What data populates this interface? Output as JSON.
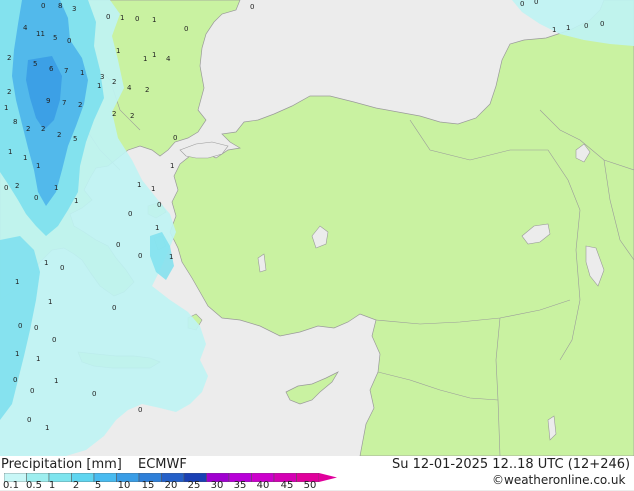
{
  "title": "Precipitation [mm]",
  "model": "ECMWF",
  "datetime": "Su 12-01-2025 12..18 UTC (12+246)",
  "credit": "©weatheronline.co.uk",
  "scale": {
    "labels": [
      "0.1",
      "0.5",
      "1",
      "2",
      "5",
      "10",
      "15",
      "20",
      "25",
      "30",
      "35",
      "40",
      "45",
      "50"
    ],
    "colors": [
      "#c8f7f7",
      "#9eeeef",
      "#7de4ee",
      "#5fd5f0",
      "#49bbf0",
      "#3a9de6",
      "#2f7fd8",
      "#2560c8",
      "#1a40b4",
      "#a000d0",
      "#b800d8",
      "#cc00cc",
      "#d400b4",
      "#e0009c"
    ]
  },
  "colors": {
    "sea": "#ececec",
    "land": "#c9f2a1",
    "coast": "#9a9a9a",
    "precip_light": "#bff3f3",
    "precip_medium": "#7fe0ee",
    "precip_heavy": "#4fb6ea"
  },
  "precip_labels": [
    {
      "t": "0"
    },
    {
      "t": "8"
    },
    {
      "t": "3"
    },
    {
      "t": "0"
    },
    {
      "t": "1"
    },
    {
      "t": "0"
    },
    {
      "t": "1"
    },
    {
      "t": "0"
    },
    {
      "t": "0"
    },
    {
      "t": "4"
    },
    {
      "t": "11"
    },
    {
      "t": "5"
    },
    {
      "t": "0"
    },
    {
      "t": "1"
    },
    {
      "t": "2"
    },
    {
      "t": "5"
    },
    {
      "t": "6"
    },
    {
      "t": "7"
    },
    {
      "t": "1"
    },
    {
      "t": "3"
    },
    {
      "t": "2"
    },
    {
      "t": "9"
    },
    {
      "t": "7"
    },
    {
      "t": "2"
    },
    {
      "t": "1"
    },
    {
      "t": "2"
    },
    {
      "t": "2"
    },
    {
      "t": "4"
    },
    {
      "t": "2"
    },
    {
      "t": "8"
    },
    {
      "t": "2"
    },
    {
      "t": "2"
    },
    {
      "t": "2"
    },
    {
      "t": "5"
    },
    {
      "t": "1"
    },
    {
      "t": "1"
    },
    {
      "t": "4"
    },
    {
      "t": "1"
    },
    {
      "t": "1"
    },
    {
      "t": "1"
    },
    {
      "t": "2"
    },
    {
      "t": "1"
    },
    {
      "t": "0"
    },
    {
      "t": "1"
    },
    {
      "t": "0"
    },
    {
      "t": "1"
    },
    {
      "t": "1"
    },
    {
      "t": "0"
    },
    {
      "t": "0"
    },
    {
      "t": "1"
    },
    {
      "t": "0"
    },
    {
      "t": "0"
    },
    {
      "t": "1"
    },
    {
      "t": "1"
    },
    {
      "t": "0"
    },
    {
      "t": "0"
    },
    {
      "t": "0"
    },
    {
      "t": "1"
    },
    {
      "t": "1"
    },
    {
      "t": "0"
    },
    {
      "t": "1"
    },
    {
      "t": "0"
    },
    {
      "t": "0"
    },
    {
      "t": "0"
    },
    {
      "t": "0"
    },
    {
      "t": "1"
    },
    {
      "t": "0"
    },
    {
      "t": "0"
    },
    {
      "t": "0"
    },
    {
      "t": "1"
    },
    {
      "t": "1"
    },
    {
      "t": "1"
    },
    {
      "t": "2"
    },
    {
      "t": "1"
    },
    {
      "t": "0"
    },
    {
      "t": "0"
    },
    {
      "t": "1"
    },
    {
      "t": "1"
    },
    {
      "t": "0"
    },
    {
      "t": "0"
    }
  ]
}
